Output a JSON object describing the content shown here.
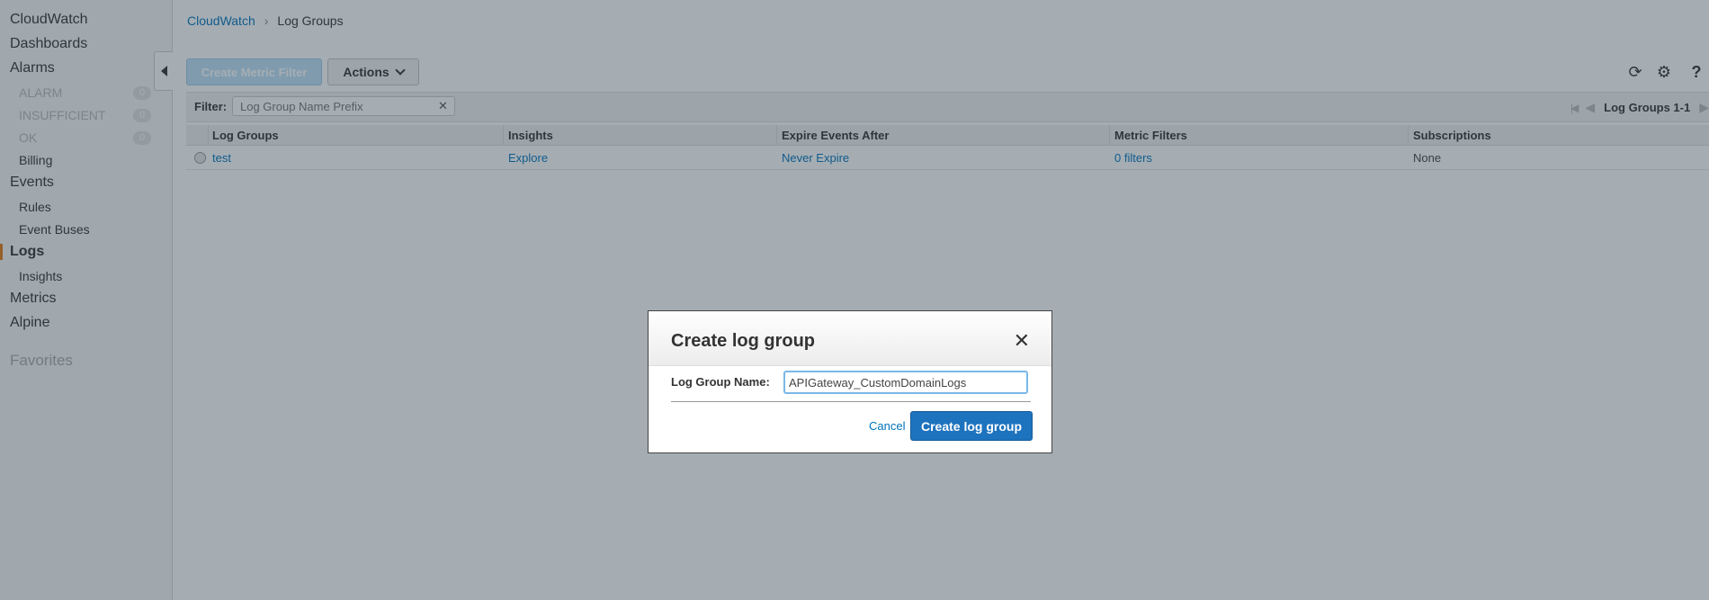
{
  "sidebar": {
    "cloudwatch": "CloudWatch",
    "dashboards": "Dashboards",
    "alarms": "Alarms",
    "alarm": {
      "label": "ALARM",
      "count": "0"
    },
    "insufficient": {
      "label": "INSUFFICIENT",
      "count": "0"
    },
    "ok": {
      "label": "OK",
      "count": "0"
    },
    "billing": "Billing",
    "events": "Events",
    "rules": "Rules",
    "event_buses": "Event Buses",
    "logs": "Logs",
    "insights": "Insights",
    "metrics": "Metrics",
    "alpine": "Alpine",
    "favorites": "Favorites"
  },
  "breadcrumb": {
    "root": "CloudWatch",
    "current": "Log Groups"
  },
  "toolbar": {
    "create_metric_filter": "Create Metric Filter",
    "actions": "Actions"
  },
  "filter": {
    "label": "Filter:",
    "placeholder": "Log Group Name Prefix"
  },
  "pager": {
    "text": "Log Groups 1-1"
  },
  "table": {
    "headers": [
      "Log Groups",
      "Insights",
      "Expire Events After",
      "Metric Filters",
      "Subscriptions"
    ],
    "rows": [
      {
        "name": "test",
        "insights": "Explore",
        "expire": "Never Expire",
        "metric_filters": "0 filters",
        "subscriptions": "None"
      }
    ]
  },
  "modal": {
    "title": "Create log group",
    "field_label": "Log Group Name:",
    "field_value": "APIGateway_CustomDomainLogs",
    "cancel": "Cancel",
    "submit": "Create log group"
  },
  "colors": {
    "accent": "#1e73be",
    "active_indicator": "#e47911",
    "link": "#0073bb"
  }
}
